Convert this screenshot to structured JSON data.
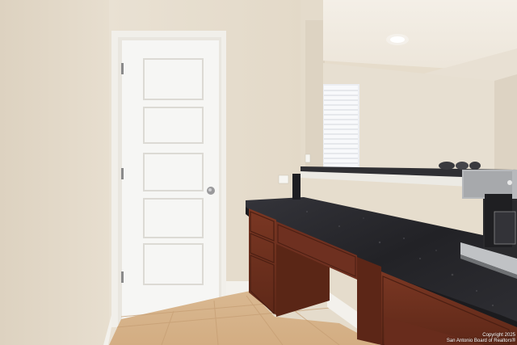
{
  "watermark": {
    "line1": "Copyright 2025",
    "line2": "San Antonio Board of Realtors®"
  },
  "colors": {
    "wall": "#e8e0d2",
    "wall_shadow": "#d8cdbb",
    "door": "#f4f4f2",
    "trim": "#f2f0ec",
    "floor_tile": "#d9b48a",
    "cabinet": "#6b2f1f",
    "countertop": "#2a2a2c",
    "window_light": "#f7f8fa"
  }
}
